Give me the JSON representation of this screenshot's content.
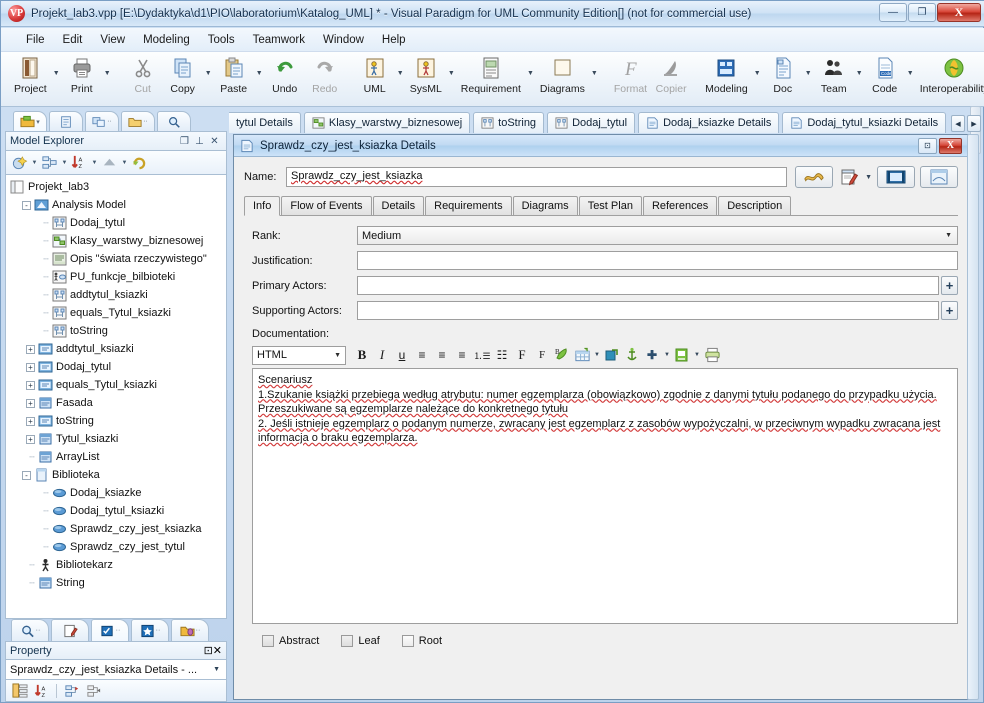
{
  "window": {
    "title": "Projekt_lab3.vpp [E:\\Dydaktyka\\d1\\PIO\\laboratorium\\Katalog_UML] * - Visual Paradigm for UML Community Edition[] (not for commercial use)",
    "minimize_label": "—",
    "maximize_label": "❐",
    "close_label": "X"
  },
  "menu": {
    "items": [
      {
        "label": "File"
      },
      {
        "label": "Edit"
      },
      {
        "label": "View"
      },
      {
        "label": "Modeling"
      },
      {
        "label": "Tools"
      },
      {
        "label": "Teamwork"
      },
      {
        "label": "Window"
      },
      {
        "label": "Help"
      }
    ]
  },
  "ribbon": {
    "groups": [
      {
        "buttons": [
          {
            "label": "Project",
            "icon": "project-icon",
            "dropdown": true,
            "disabled": false
          },
          {
            "label": "Print",
            "icon": "print-icon",
            "dropdown": true,
            "disabled": false
          }
        ]
      },
      {
        "buttons": [
          {
            "label": "Cut",
            "icon": "scissors-icon",
            "dropdown": false,
            "disabled": true
          },
          {
            "label": "Copy",
            "icon": "copy-icon",
            "dropdown": true,
            "disabled": false
          },
          {
            "label": "Paste",
            "icon": "paste-icon",
            "dropdown": true,
            "disabled": false
          },
          {
            "label": "Undo",
            "icon": "undo-icon",
            "dropdown": false,
            "disabled": false
          },
          {
            "label": "Redo",
            "icon": "redo-icon",
            "dropdown": false,
            "disabled": true
          }
        ]
      },
      {
        "buttons": [
          {
            "label": "UML",
            "icon": "uml-icon",
            "dropdown": true,
            "disabled": false
          },
          {
            "label": "SysML",
            "icon": "sysml-icon",
            "dropdown": true,
            "disabled": false
          },
          {
            "label": "Requirement",
            "icon": "requirement-icon",
            "dropdown": true,
            "disabled": false
          },
          {
            "label": "Diagrams",
            "icon": "diagrams-icon",
            "dropdown": true,
            "disabled": false
          }
        ]
      },
      {
        "buttons": [
          {
            "label": "Format",
            "icon": "format-icon",
            "dropdown": false,
            "disabled": true
          },
          {
            "label": "Copier",
            "icon": "copier-icon",
            "dropdown": false,
            "disabled": true
          }
        ]
      },
      {
        "buttons": [
          {
            "label": "Modeling",
            "icon": "modeling-icon",
            "dropdown": true,
            "disabled": false
          },
          {
            "label": "Doc",
            "icon": "doc-icon",
            "dropdown": true,
            "disabled": false
          },
          {
            "label": "Team",
            "icon": "team-icon",
            "dropdown": true,
            "disabled": false
          },
          {
            "label": "Code",
            "icon": "code-icon",
            "dropdown": true,
            "disabled": false
          },
          {
            "label": "Interoperability",
            "icon": "interoperability-icon",
            "dropdown": true,
            "disabled": false
          }
        ]
      }
    ]
  },
  "model_explorer": {
    "title": "Model Explorer",
    "header_buttons": [
      {
        "name": "restore-icon",
        "label": "❐"
      },
      {
        "name": "pin-icon",
        "label": "⊥"
      },
      {
        "name": "close-icon",
        "label": "✕"
      }
    ],
    "toolbar": [
      {
        "name": "new-model-icon",
        "dropdown": true
      },
      {
        "name": "model-structure-icon",
        "dropdown": true
      },
      {
        "name": "sort-az-icon",
        "dropdown": true
      },
      {
        "name": "collapse-up-icon",
        "dropdown": true
      },
      {
        "name": "refresh-icon",
        "dropdown": false
      }
    ],
    "tree": [
      {
        "label": "Projekt_lab3",
        "indent": 0,
        "expander": "",
        "icon": "project-node-icon"
      },
      {
        "label": "Analysis Model",
        "indent": 1,
        "expander": "-",
        "icon": "model-node-icon"
      },
      {
        "label": "Dodaj_tytul",
        "indent": 2,
        "expander": "",
        "icon": "sequence-diagram-icon"
      },
      {
        "label": "Klasy_warstwy_biznesowej",
        "indent": 2,
        "expander": "",
        "icon": "class-diagram-icon"
      },
      {
        "label": "Opis \"świata rzeczywistego\"",
        "indent": 2,
        "expander": "",
        "icon": "text-diagram-icon"
      },
      {
        "label": "PU_funkcje_bilbioteki",
        "indent": 2,
        "expander": "",
        "icon": "usecase-diagram-icon"
      },
      {
        "label": "addtytul_ksiazki",
        "indent": 2,
        "expander": "",
        "icon": "sequence-diagram-icon"
      },
      {
        "label": "equals_Tytul_ksiazki",
        "indent": 2,
        "expander": "",
        "icon": "sequence-diagram-icon"
      },
      {
        "label": "toString",
        "indent": 2,
        "expander": "",
        "icon": "sequence-diagram-icon"
      },
      {
        "label": "addtytul_ksiazki",
        "indent": 1,
        "expander": "+",
        "icon": "interaction-icon"
      },
      {
        "label": "Dodaj_tytul",
        "indent": 1,
        "expander": "+",
        "icon": "interaction-icon"
      },
      {
        "label": "equals_Tytul_ksiazki",
        "indent": 1,
        "expander": "+",
        "icon": "interaction-icon"
      },
      {
        "label": "Fasada",
        "indent": 1,
        "expander": "+",
        "icon": "class-icon"
      },
      {
        "label": "toString",
        "indent": 1,
        "expander": "+",
        "icon": "interaction-icon"
      },
      {
        "label": "Tytul_ksiazki",
        "indent": 1,
        "expander": "+",
        "icon": "class-icon"
      },
      {
        "label": "ArrayList",
        "indent": 1,
        "expander": "",
        "icon": "class-icon"
      },
      {
        "label": "Biblioteka",
        "indent": 1,
        "expander": "-",
        "icon": "package-icon"
      },
      {
        "label": "Dodaj_ksiazke",
        "indent": 2,
        "expander": "",
        "icon": "usecase-icon"
      },
      {
        "label": "Dodaj_tytul_ksiazki",
        "indent": 2,
        "expander": "",
        "icon": "usecase-icon"
      },
      {
        "label": "Sprawdz_czy_jest_ksiazka",
        "indent": 2,
        "expander": "",
        "icon": "usecase-icon"
      },
      {
        "label": "Sprawdz_czy_jest_tytul",
        "indent": 2,
        "expander": "",
        "icon": "usecase-icon"
      },
      {
        "label": "Bibliotekarz",
        "indent": 1,
        "expander": "",
        "icon": "actor-icon"
      },
      {
        "label": "String",
        "indent": 1,
        "expander": "",
        "icon": "class-icon"
      }
    ]
  },
  "property_panel": {
    "title": "Property",
    "header_buttons": [
      {
        "name": "restore-icon",
        "label": "⊡"
      },
      {
        "name": "close-icon",
        "label": "✕"
      }
    ],
    "selected_value": "Sprawdz_czy_jest_ksiazka Details - ...",
    "dropdown_arrow": "▼",
    "toolbar": [
      {
        "name": "categorized-view-icon"
      },
      {
        "name": "sort-az-icon"
      },
      {
        "name": "expand-all-icon"
      },
      {
        "name": "collapse-all-icon"
      }
    ],
    "tabs": [
      {
        "name": "search-tab-icon",
        "active": false
      },
      {
        "name": "edit-tab-icon",
        "active": false
      },
      {
        "name": "checklist-tab-icon",
        "active": true
      },
      {
        "name": "favorites-tab-icon",
        "active": false
      },
      {
        "name": "layers-tab-icon",
        "active": false
      }
    ]
  },
  "explorer_tabs": [
    {
      "name": "model-explorer-tab",
      "active": true
    },
    {
      "name": "class-repository-tab",
      "active": false
    },
    {
      "name": "diagram-navigator-tab",
      "active": false
    },
    {
      "name": "file-explorer-tab",
      "active": false
    },
    {
      "name": "search-tab",
      "active": false
    }
  ],
  "document_tabs": {
    "tabs": [
      {
        "label": "tytul Details",
        "icon": "details-doc-icon",
        "truncated": true
      },
      {
        "label": "Klasy_warstwy_biznesowej",
        "icon": "class-diagram-icon",
        "truncated": false
      },
      {
        "label": "toString",
        "icon": "sequence-diagram-icon",
        "truncated": false
      },
      {
        "label": "Dodaj_tytul",
        "icon": "sequence-diagram-icon",
        "truncated": false
      },
      {
        "label": "Dodaj_ksiazke Details",
        "icon": "details-doc-icon",
        "truncated": false
      },
      {
        "label": "Dodaj_tytul_ksiazki Details",
        "icon": "details-doc-icon",
        "truncated": false
      }
    ],
    "nav_prev": "◀",
    "nav_next": "▶"
  },
  "details_window": {
    "title": "Sprawdz_czy_jest_ksiazka Details",
    "title_icon": "details-doc-icon",
    "minimize_label": "⊡",
    "close_label": "X",
    "name_label": "Name:",
    "name_value": "Sprawdz_czy_jest_ksiazka",
    "toolbar_buttons": [
      {
        "name": "open-specification-button",
        "icon": "yellow-ribbon-icon"
      },
      {
        "name": "edit-properties-button",
        "icon": "notepad-pencil-icon",
        "dropdown": true
      },
      {
        "name": "show-in-diagram-button",
        "icon": "diagram-filmstrip-icon"
      },
      {
        "name": "report-button",
        "icon": "report-page-icon"
      }
    ],
    "tabs": [
      {
        "label": "Info",
        "active": true
      },
      {
        "label": "Flow of Events",
        "active": false
      },
      {
        "label": "Details",
        "active": false
      },
      {
        "label": "Requirements",
        "active": false
      },
      {
        "label": "Diagrams",
        "active": false
      },
      {
        "label": "Test Plan",
        "active": false
      },
      {
        "label": "References",
        "active": false
      },
      {
        "label": "Description",
        "active": false
      }
    ],
    "fields": {
      "rank_label": "Rank:",
      "rank_value": "Medium",
      "rank_arrow": "▼",
      "justification_label": "Justification:",
      "justification_value": "",
      "primary_actors_label": "Primary Actors:",
      "primary_actors_value": "",
      "supporting_actors_label": "Supporting Actors:",
      "supporting_actors_value": "",
      "add_button_label": "+",
      "documentation_label": "Documentation:"
    },
    "editor": {
      "format_value": "HTML",
      "format_arrow": "▼",
      "buttons": [
        {
          "name": "bold-button",
          "glyph": "B",
          "style": "bold"
        },
        {
          "name": "italic-button",
          "glyph": "I",
          "style": "ital"
        },
        {
          "name": "underline-button",
          "glyph": "u",
          "style": "undl"
        },
        {
          "name": "align-left-button",
          "glyph": "≡",
          "style": ""
        },
        {
          "name": "align-center-button",
          "glyph": "≡",
          "style": ""
        },
        {
          "name": "align-right-button",
          "glyph": "≡",
          "style": ""
        },
        {
          "name": "ordered-list-button",
          "glyph": "⒈☰",
          "style": ""
        },
        {
          "name": "bullet-list-button",
          "glyph": "☷",
          "style": ""
        },
        {
          "name": "font-increase-button",
          "glyph": "F",
          "style": "serif"
        },
        {
          "name": "font-decrease-button",
          "glyph": "F",
          "style": "serif"
        },
        {
          "name": "font-color-button",
          "glyph": "",
          "style": ""
        },
        {
          "name": "insert-table-button",
          "glyph": "",
          "style": "",
          "dropdown": true
        },
        {
          "name": "insert-link-button",
          "glyph": "",
          "style": ""
        },
        {
          "name": "insert-anchor-button",
          "glyph": "",
          "style": ""
        },
        {
          "name": "insert-symbol-button",
          "glyph": "✚",
          "style": "",
          "dropdown": true
        },
        {
          "name": "insert-image-button",
          "glyph": "",
          "style": "",
          "dropdown": true
        },
        {
          "name": "print-button",
          "glyph": "",
          "style": ""
        }
      ]
    },
    "documentation": {
      "lines": [
        "Scenariusz",
        "1.Szukanie książki przebiega według atrybutu:  numer egzemplarza (obowiązkowo) zgodnie z danymi tytułu podanego do przypadku użycia. Przeszukiwane są egzemplarze należące do konkretnego tytułu",
        "2. Jeśli istnieje egzemplarz o podanym numerze, zwracany jest egzemplarz z zasobów wypożyczalni, w przeciwnym wypadku zwracana jest informacja o braku egzemplarza."
      ]
    },
    "checkboxes": [
      {
        "label": "Abstract",
        "checked": false,
        "disabled": true
      },
      {
        "label": "Leaf",
        "checked": false,
        "disabled": true
      },
      {
        "label": "Root",
        "checked": false,
        "disabled": false
      }
    ]
  },
  "colors": {
    "accent": "#3a6ea5",
    "title_gradient_start": "#e8f1fb",
    "close_red": "#b52516",
    "panel_border": "#a9bed3",
    "spell_error": "#d23b3b"
  }
}
